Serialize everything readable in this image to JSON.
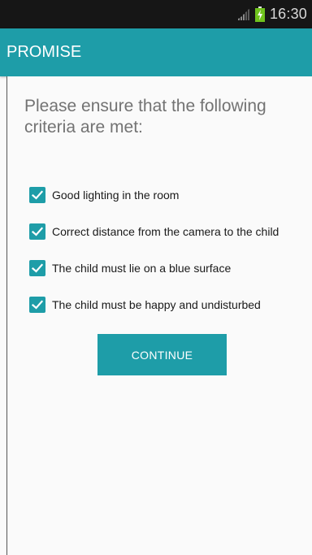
{
  "status_bar": {
    "time": "16:30",
    "icons": [
      "signal-icon",
      "battery-charging-icon"
    ]
  },
  "app_bar": {
    "title": "PROMISE"
  },
  "main": {
    "instruction": "Please ensure that the following criteria are met:",
    "criteria": [
      {
        "label": "Good lighting in the room",
        "checked": true
      },
      {
        "label": "Correct distance from the camera to the child",
        "checked": true
      },
      {
        "label": "The child must lie on a blue surface",
        "checked": true
      },
      {
        "label": "The child must be happy and undisturbed",
        "checked": true
      }
    ],
    "continue_label": "CONTINUE"
  },
  "colors": {
    "accent": "#1e9da8",
    "status_bar": "#161616",
    "background": "#fafafa",
    "instruction_text": "#737373"
  }
}
